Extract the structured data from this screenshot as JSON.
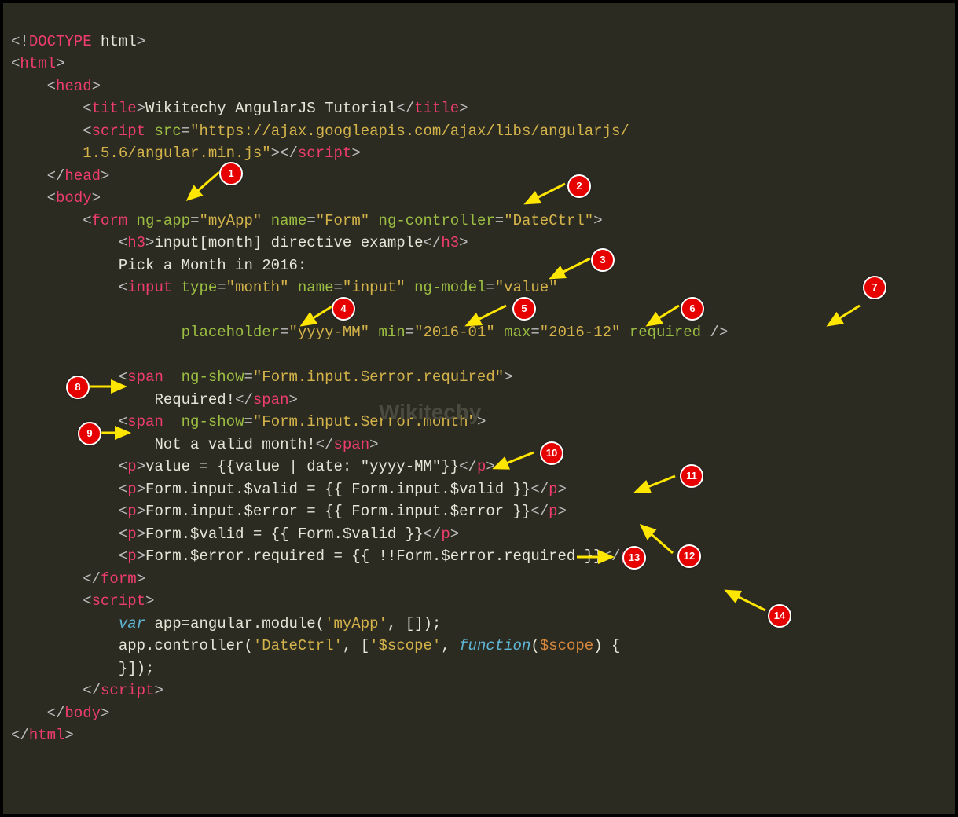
{
  "code": {
    "l1": {
      "doctype_open": "<!",
      "doctype_tag": "DOCTYPE",
      "doctype_text": " html",
      "doctype_close": ">"
    },
    "l2": {
      "o": "<",
      "tag": "html",
      "c": ">"
    },
    "l3": {
      "o": "<",
      "tag": "head",
      "c": ">"
    },
    "l4": {
      "o1": "<",
      "tag1": "title",
      "c1": ">",
      "text": "Wikitechy AngularJS Tutorial",
      "o2": "</",
      "tag2": "title",
      "c2": ">"
    },
    "l5": {
      "o": "<",
      "tag": "script",
      "sp": " ",
      "an": "src",
      "eq": "=",
      "av": "\"https://ajax.googleapis.com/ajax/libs/angularjs/"
    },
    "l6": {
      "av": "1.5.6/angular.min.js\"",
      "c1": ">",
      "o2": "</",
      "tag": "script",
      "c2": ">"
    },
    "l7": {
      "o": "</",
      "tag": "head",
      "c": ">"
    },
    "l8": {
      "o": "<",
      "tag": "body",
      "c": ">"
    },
    "l9": {
      "o": "<",
      "tag": "form",
      "sp": " ",
      "an1": "ng-app",
      "eq": "=",
      "av1": "\"myApp\"",
      "an2": "name",
      "av2": "\"Form\"",
      "an3": "ng-controller",
      "av3": "\"DateCtrl\"",
      "c": ">"
    },
    "l10": {
      "o": "<",
      "tag": "h3",
      "c": ">",
      "text": "input[month] directive example",
      "o2": "</",
      "tag2": "h3",
      "c2": ">"
    },
    "l11": {
      "text": "Pick a Month in 2016:"
    },
    "l12": {
      "o": "<",
      "tag": "input",
      "sp": " ",
      "an1": "type",
      "av1": "\"month\"",
      "an2": "name",
      "av2": "\"input\"",
      "an3": "ng-model",
      "av3": "\"value\""
    },
    "l13": {
      "an1": "placeholder",
      "av1": "\"yyyy-MM\"",
      "an2": "min",
      "av2": "\"2016-01\"",
      "an3": "max",
      "av3": "\"2016-12\"",
      "an4": "required",
      "c": " />"
    },
    "l14_empty": "",
    "l15": {
      "o": "<",
      "tag": "span",
      "sp": "  ",
      "an": "ng-show",
      "av": "\"Form.input.$error.required\"",
      "c": ">"
    },
    "l16": {
      "text": "Required!",
      "o": "</",
      "tag": "span",
      "c": ">"
    },
    "l17": {
      "o": "<",
      "tag": "span",
      "sp": "  ",
      "an": "ng-show",
      "av": "\"Form.input.$error.month\"",
      "c": ">"
    },
    "l18": {
      "text": "Not a valid month!",
      "o": "</",
      "tag": "span",
      "c": ">"
    },
    "l19": {
      "o": "<",
      "tag": "p",
      "c": ">",
      "text": "value = {{value | date: \"yyyy-MM\"}}",
      "o2": "</",
      "tag2": "p",
      "c2": ">"
    },
    "l20": {
      "o": "<",
      "tag": "p",
      "c": ">",
      "text": "Form.input.$valid = {{ Form.input.$valid }}",
      "o2": "</",
      "tag2": "p",
      "c2": ">"
    },
    "l21": {
      "o": "<",
      "tag": "p",
      "c": ">",
      "text": "Form.input.$error = {{ Form.input.$error }}",
      "o2": "</",
      "tag2": "p",
      "c2": ">"
    },
    "l22": {
      "o": "<",
      "tag": "p",
      "c": ">",
      "text": "Form.$valid = {{ Form.$valid }}",
      "o2": "</",
      "tag2": "p",
      "c2": ">"
    },
    "l23": {
      "o": "<",
      "tag": "p",
      "c": ">",
      "text": "Form.$error.required = {{ !!Form.$error.required }}",
      "o2": "</",
      "tag2": "p",
      "c2": ">"
    },
    "l24": {
      "o": "</",
      "tag": "form",
      "c": ">"
    },
    "l25": {
      "o": "<",
      "tag": "script",
      "c": ">"
    },
    "l26": {
      "kw": "var",
      "text": " app=angular.module(",
      "s": "'myApp'",
      "text2": ", []);"
    },
    "l27": {
      "text": "app.controller(",
      "s1": "'DateCtrl'",
      "text2": ", [",
      "s2": "'$scope'",
      "text3": ", ",
      "fn": "function",
      "text4": "(",
      "p": "$scope",
      "text5": ") {"
    },
    "l28": {
      "text": "}]);"
    },
    "l29": {
      "o": "</",
      "tag": "script",
      "c": ">"
    },
    "l30": {
      "o": "</",
      "tag": "body",
      "c": ">"
    },
    "l31": {
      "o": "</",
      "tag": "html",
      "c": ">"
    }
  },
  "badges": {
    "b1": "1",
    "b2": "2",
    "b3": "3",
    "b4": "4",
    "b5": "5",
    "b6": "6",
    "b7": "7",
    "b8": "8",
    "b9": "9",
    "b10": "10",
    "b11": "11",
    "b12": "12",
    "b13": "13",
    "b14": "14"
  },
  "watermark": "Wikitechy"
}
